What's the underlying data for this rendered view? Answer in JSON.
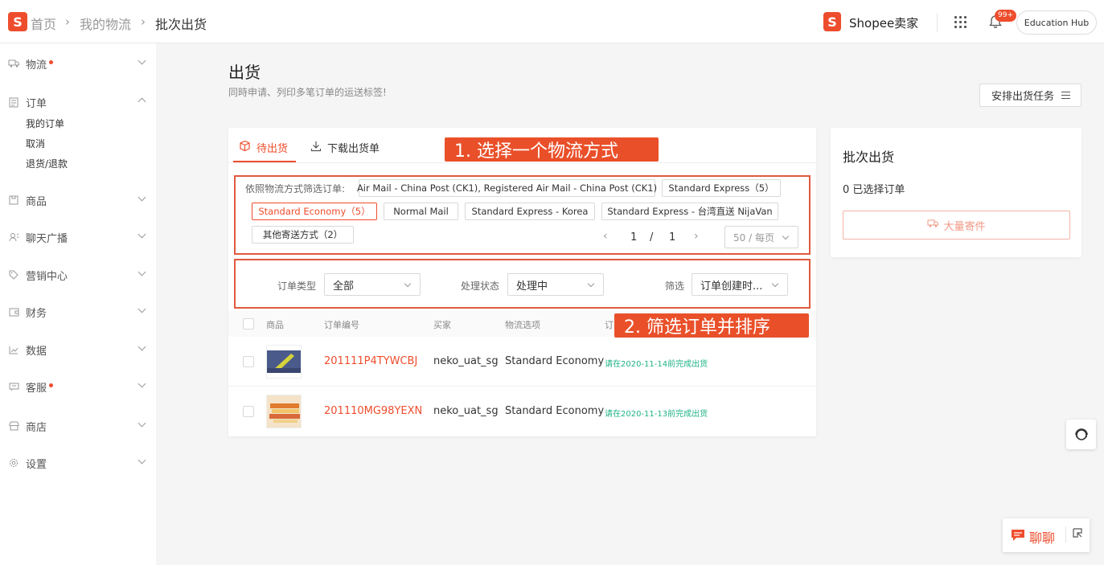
{
  "breadcrumb": {
    "home": "首页",
    "level2": "我的物流",
    "current": "批次出货"
  },
  "header": {
    "brand": "Shopee卖家",
    "notif_badge": "99+",
    "hub_label": "Education Hub",
    "logo_letter": "S"
  },
  "sidebar": {
    "items": [
      {
        "label": "物流",
        "icon": "truck-icon",
        "dot": true
      },
      {
        "label": "订单",
        "icon": "order-icon",
        "expanded": true,
        "subitems": [
          "我的订单",
          "取消",
          "退货/退款"
        ]
      },
      {
        "label": "商品",
        "icon": "product-icon"
      },
      {
        "label": "聊天广播",
        "icon": "broadcast-icon"
      },
      {
        "label": "营销中心",
        "icon": "tag-icon"
      },
      {
        "label": "财务",
        "icon": "wallet-icon"
      },
      {
        "label": "数据",
        "icon": "chart-icon"
      },
      {
        "label": "客服",
        "icon": "support-icon",
        "dot": true
      },
      {
        "label": "商店",
        "icon": "shop-icon"
      },
      {
        "label": "设置",
        "icon": "gear-icon"
      }
    ]
  },
  "page": {
    "title": "出货",
    "subtitle": "同時申请、列印多笔订单的运送标签!",
    "arrange_button": "安排出货任务"
  },
  "tabs": {
    "pending": "待出货",
    "download": "下载出货单"
  },
  "filter": {
    "label": "依照物流方式筛选订单:",
    "channels": [
      {
        "label": "Air Mail - China Post (CK1), Registered Air Mail - China Post (CK1)"
      },
      {
        "label": "Standard Express（5）"
      },
      {
        "label": "Standard Economy（5）",
        "active": true
      },
      {
        "label": "Normal Mail"
      },
      {
        "label": "Standard Express - Korea"
      },
      {
        "label": "Standard Express - 台湾直送 NijaVan"
      },
      {
        "label": "其他寄送方式（2）"
      }
    ],
    "pagination": {
      "current": "1",
      "sep": "/",
      "total": "1",
      "per_page": "50 / 每页"
    }
  },
  "filters2": {
    "order_type_label": "订单类型",
    "order_type_value": "全部",
    "status_label": "处理状态",
    "status_value": "处理中",
    "sort_label": "筛选",
    "sort_value": "订单创建时..."
  },
  "annotations": {
    "step1": "1. 选择一个物流方式",
    "step2": "2. 筛选订单并排序"
  },
  "table": {
    "headers": [
      "商品",
      "订单编号",
      "买家",
      "物流选项",
      "订"
    ],
    "rows": [
      {
        "order_no": "201111P4TYWCBJ",
        "buyer": "neko_uat_sg",
        "logistics": "Standard Economy",
        "due": "请在2020-11-14前完成出货"
      },
      {
        "order_no": "201110MG98YEXN",
        "buyer": "neko_uat_sg",
        "logistics": "Standard Economy",
        "due": "请在2020-11-13前完成出货"
      }
    ]
  },
  "batch_panel": {
    "title": "批次出货",
    "selected": "0 已选择订单",
    "mass_ship": "大量寄件"
  },
  "chat": {
    "label": "聊聊"
  },
  "colors": {
    "brand": "#ee4d2d",
    "annotation": "#e9502a",
    "due_text": "#20b386"
  }
}
